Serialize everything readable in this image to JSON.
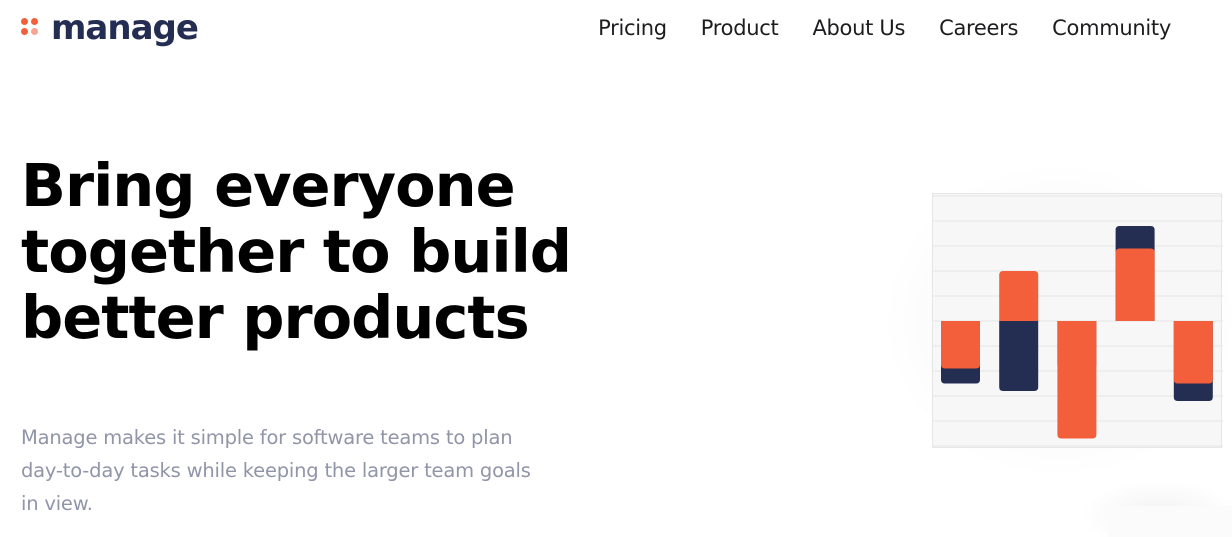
{
  "brand": {
    "name": "manage",
    "icon": "four-dots-logo-icon"
  },
  "nav": {
    "items": [
      {
        "label": "Pricing"
      },
      {
        "label": "Product"
      },
      {
        "label": "About Us"
      },
      {
        "label": "Careers"
      },
      {
        "label": "Community"
      }
    ]
  },
  "hero": {
    "title_lines": [
      "Bring everyone",
      "together to build",
      "better products"
    ],
    "description_lines": [
      "Manage makes it simple for software teams to plan",
      "day-to-day tasks while keeping the larger team goals",
      "in view."
    ]
  },
  "colors": {
    "accent": "#f25f3a",
    "navy": "#242d52",
    "muted": "#9095a8"
  },
  "chart_data": {
    "type": "bar",
    "categories": [
      "",
      "",
      "",
      "",
      ""
    ],
    "series": [
      {
        "values": [
          -1.25,
          -1.4,
          -0.95,
          1.9,
          -1.6
        ]
      },
      {
        "values": [
          -0.95,
          1.0,
          -2.35,
          1.45,
          -1.25
        ]
      }
    ],
    "ylim": [
      -2.5,
      2.5
    ],
    "grid": true,
    "legend": "none"
  }
}
